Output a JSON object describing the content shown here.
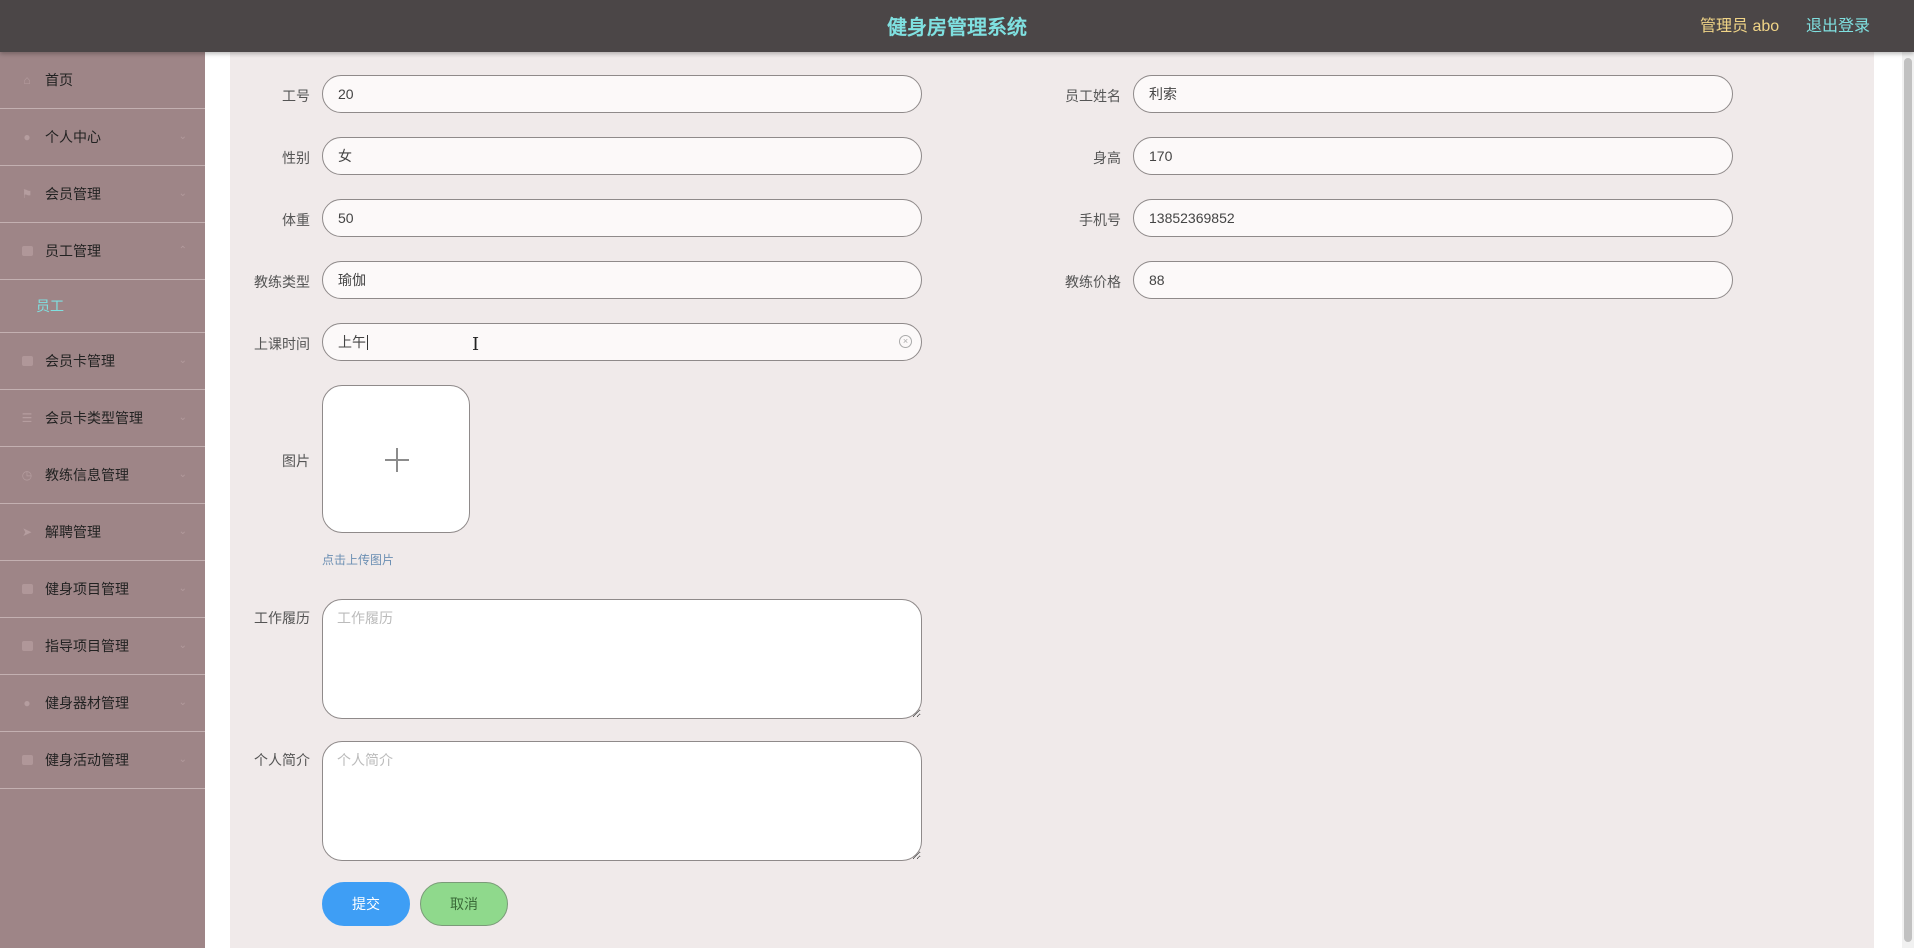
{
  "header": {
    "title": "健身房管理系统",
    "admin_text": "管理员 abo",
    "logout_label": "退出登录"
  },
  "sidebar": {
    "items": [
      {
        "label": "首页",
        "icon": "home-icon"
      },
      {
        "label": "个人中心",
        "icon": "user-icon"
      },
      {
        "label": "会员管理",
        "icon": "flag-icon"
      },
      {
        "label": "员工管理",
        "icon": "chat-icon",
        "expanded": true,
        "children": [
          {
            "label": "员工",
            "active": true
          }
        ]
      },
      {
        "label": "会员卡管理",
        "icon": "card-icon"
      },
      {
        "label": "会员卡类型管理",
        "icon": "list-icon"
      },
      {
        "label": "教练信息管理",
        "icon": "clock-icon"
      },
      {
        "label": "解聘管理",
        "icon": "send-icon"
      },
      {
        "label": "健身项目管理",
        "icon": "picture-icon"
      },
      {
        "label": "指导项目管理",
        "icon": "book-icon"
      },
      {
        "label": "健身器材管理",
        "icon": "person-icon"
      },
      {
        "label": "健身活动管理",
        "icon": "folder-icon"
      }
    ],
    "accent_color": "#7fe0e0"
  },
  "form": {
    "gonghao": {
      "label": "工号",
      "value": "20"
    },
    "yuangongxingming": {
      "label": "员工姓名",
      "value": "利索"
    },
    "xingbie": {
      "label": "性别",
      "value": "女"
    },
    "shengao": {
      "label": "身高",
      "value": "170"
    },
    "tizhong": {
      "label": "体重",
      "value": "50"
    },
    "shoujihao": {
      "label": "手机号",
      "value": "13852369852"
    },
    "jiaolianleixing": {
      "label": "教练类型",
      "value": "瑜伽"
    },
    "jiaolianjiage": {
      "label": "教练价格",
      "value": "88"
    },
    "shangkeshijian": {
      "label": "上课时间",
      "value": "上午"
    },
    "tupian": {
      "label": "图片",
      "upload_hint": "点击上传图片"
    },
    "gongzuolvli": {
      "label": "工作履历",
      "placeholder": "工作履历",
      "value": ""
    },
    "gerenjianjie": {
      "label": "个人简介",
      "placeholder": "个人简介",
      "value": ""
    },
    "submit_label": "提交",
    "cancel_label": "取消"
  }
}
